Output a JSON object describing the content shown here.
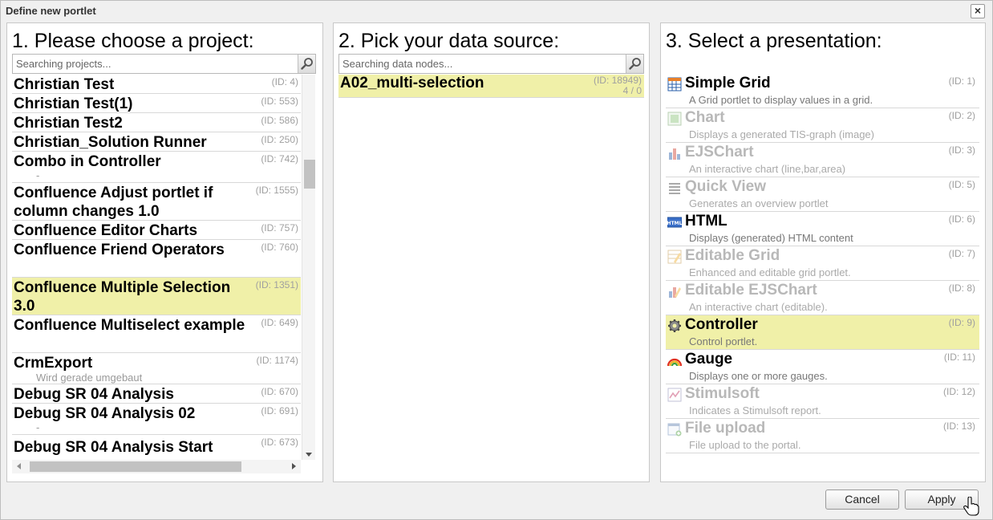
{
  "dialog": {
    "title": "Define new portlet",
    "close_glyph": "×"
  },
  "projects": {
    "heading": "1. Please choose a project:",
    "search_placeholder": "Searching projects...",
    "items": [
      {
        "name": "Christian Test",
        "id": "(ID: 4)"
      },
      {
        "name": "Christian Test(1)",
        "id": "(ID: 553)"
      },
      {
        "name": "Christian Test2",
        "id": "(ID: 586)"
      },
      {
        "name": "Christian_Solution Runner",
        "id": "(ID: 250)"
      },
      {
        "name": "Combo in Controller",
        "id": "(ID: 742)",
        "sub": "-"
      },
      {
        "name": "Confluence Adjust portlet if column changes 1.0",
        "id": "(ID: 1555)"
      },
      {
        "name": "Confluence Editor Charts",
        "id": "(ID: 757)"
      },
      {
        "name": "Confluence Friend Operators",
        "id": "(ID: 760)"
      },
      {
        "name": "Confluence Multiple Selection 3.0",
        "id": "(ID: 1351)",
        "selected": true
      },
      {
        "name": "Confluence Multiselect example",
        "id": "(ID: 649)"
      },
      {
        "name": "CrmExport",
        "id": "(ID: 1174)",
        "sub": "Wird gerade umgebaut"
      },
      {
        "name": "Debug SR 04 Analysis",
        "id": "(ID: 670)"
      },
      {
        "name": "Debug SR 04 Analysis 02",
        "id": "(ID: 691)",
        "sub": "-"
      },
      {
        "name": "Debug SR 04 Analysis Start",
        "id": "(ID: 673)"
      }
    ]
  },
  "datasource": {
    "heading": "2. Pick your data source:",
    "search_placeholder": "Searching data nodes...",
    "items": [
      {
        "name": "A02_multi-selection",
        "id": "(ID: 18949)",
        "count": "4 / 0",
        "selected": true
      }
    ]
  },
  "presentation": {
    "heading": "3. Select a presentation:",
    "items": [
      {
        "name": "Simple Grid",
        "desc": "A Grid portlet to display values in a grid.",
        "id": "(ID: 1)",
        "icon": "grid-icon",
        "enabled": true
      },
      {
        "name": "Chart",
        "desc": "Displays a generated TIS-graph (image)",
        "id": "(ID: 2)",
        "icon": "chart-image-icon",
        "enabled": false
      },
      {
        "name": "EJSChart",
        "desc": "An interactive chart (line,bar,area)",
        "id": "(ID: 3)",
        "icon": "bar-chart-icon",
        "enabled": false
      },
      {
        "name": "Quick View",
        "desc": "Generates an overview portlet",
        "id": "(ID: 5)",
        "icon": "list-icon",
        "enabled": false
      },
      {
        "name": "HTML",
        "desc": "Displays (generated) HTML content",
        "id": "(ID: 6)",
        "icon": "html-icon",
        "enabled": true
      },
      {
        "name": "Editable Grid",
        "desc": "Enhanced and editable grid portlet.",
        "id": "(ID: 7)",
        "icon": "editable-grid-icon",
        "enabled": false
      },
      {
        "name": "Editable EJSChart",
        "desc": "An interactive chart (editable).",
        "id": "(ID: 8)",
        "icon": "editable-chart-icon",
        "enabled": false
      },
      {
        "name": "Controller",
        "desc": "Control portlet.",
        "id": "(ID: 9)",
        "icon": "gear-icon",
        "enabled": true,
        "selected": true
      },
      {
        "name": "Gauge",
        "desc": "Displays one or more gauges.",
        "id": "(ID: 11)",
        "icon": "rainbow-gauge-icon",
        "enabled": true
      },
      {
        "name": "Stimulsoft",
        "desc": "Indicates a Stimulsoft report.",
        "id": "(ID: 12)",
        "icon": "report-icon",
        "enabled": false
      },
      {
        "name": "File upload",
        "desc": "File upload to the portal.",
        "id": "(ID: 13)",
        "icon": "upload-icon",
        "enabled": false
      }
    ]
  },
  "buttons": {
    "cancel": "Cancel",
    "apply": "Apply"
  }
}
